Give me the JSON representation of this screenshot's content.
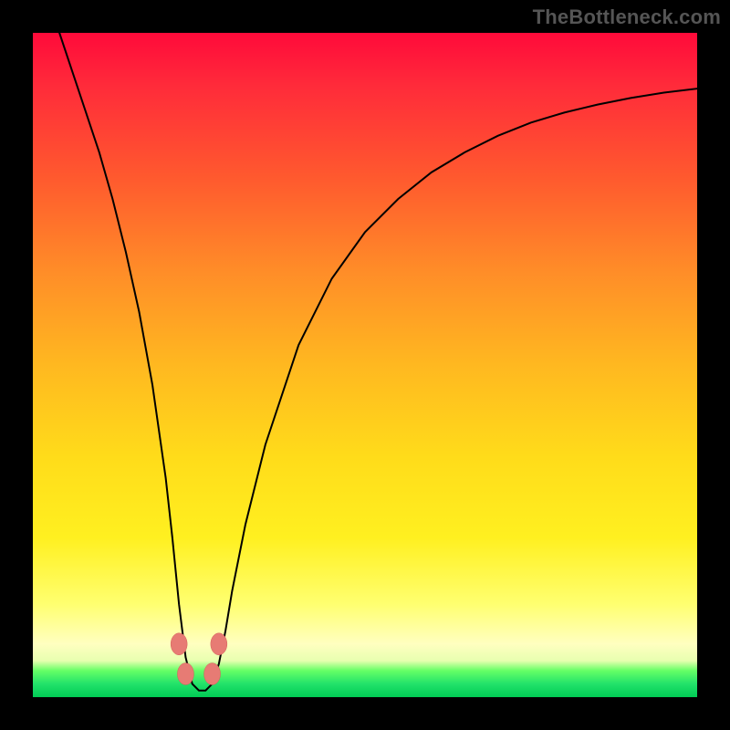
{
  "watermark": "TheBottleneck.com",
  "colors": {
    "background": "#000000",
    "gradient_top": "#ff0a3a",
    "gradient_bottom": "#00cc55",
    "curve": "#000000",
    "bead": "#e77b74"
  },
  "chart_data": {
    "type": "line",
    "title": "",
    "xlabel": "",
    "ylabel": "",
    "xlim": [
      0,
      100
    ],
    "ylim": [
      0,
      100
    ],
    "grid": false,
    "legend": false,
    "note": "Background is a vertical red-to-green gradient. The black curve is a V-shape: steep left arm falls from top to a flat bottom near x≈25, then a right arm rises concave to top-right. Four salmon beads sit near the bottom of the V on the green band.",
    "series": [
      {
        "name": "bottleneck_curve",
        "x": [
          4,
          6,
          8,
          10,
          12,
          14,
          16,
          18,
          20,
          21,
          22,
          23,
          24,
          25,
          26,
          27,
          28,
          29,
          30,
          32,
          35,
          40,
          45,
          50,
          55,
          60,
          65,
          70,
          75,
          80,
          85,
          90,
          95,
          100
        ],
        "y": [
          100,
          94,
          88,
          82,
          75,
          67,
          58,
          47,
          33,
          24,
          14,
          6,
          2,
          1,
          1,
          2,
          5,
          10,
          16,
          26,
          38,
          53,
          63,
          70,
          75,
          79,
          82,
          84.5,
          86.5,
          88,
          89.2,
          90.2,
          91,
          91.6
        ]
      }
    ],
    "markers": [
      {
        "name": "bead-left-upper",
        "x": 22.0,
        "y": 8.0
      },
      {
        "name": "bead-left-lower",
        "x": 23.0,
        "y": 3.5
      },
      {
        "name": "bead-right-lower",
        "x": 27.0,
        "y": 3.5
      },
      {
        "name": "bead-right-upper",
        "x": 28.0,
        "y": 8.0
      }
    ]
  }
}
